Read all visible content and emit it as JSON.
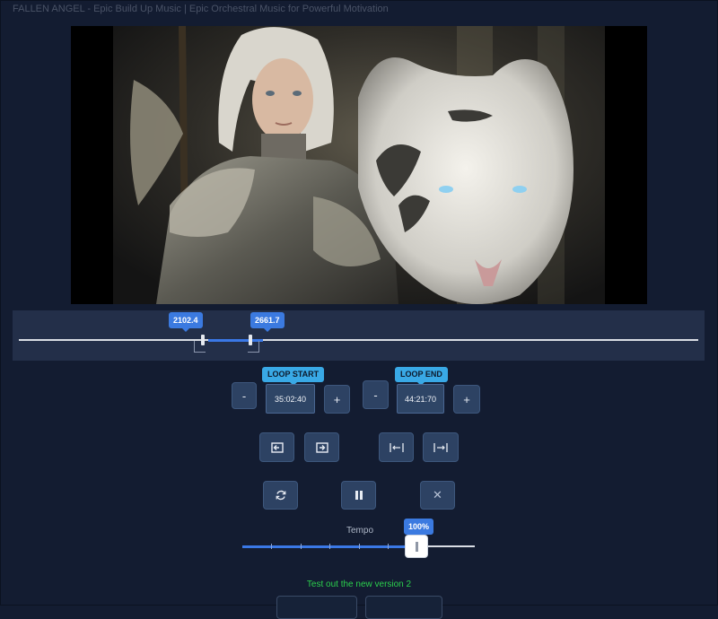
{
  "window": {
    "title": "FALLEN ANGEL - Epic Build Up Music | Epic Orchestral Music for Powerful Motivation"
  },
  "timeline": {
    "loop_start_value": "2102.4",
    "loop_end_value": "2661.7"
  },
  "loop": {
    "start_label": "LOOP START",
    "start_time": "35:02:40",
    "end_label": "LOOP END",
    "end_time": "44:21:70",
    "minus_label": "-",
    "plus_label": "+"
  },
  "controls": {
    "set_start_icon": "bracket-left-arrow-icon",
    "set_end_icon": "bracket-right-arrow-icon",
    "jump_start_icon": "skip-to-start-icon",
    "jump_end_icon": "skip-to-end-icon",
    "loop_icon": "refresh-icon",
    "pause_icon": "pause-icon",
    "close_icon": "close-icon",
    "close_glyph": "✕"
  },
  "tempo": {
    "label": "Tempo",
    "value_label": "100%",
    "fraction": 0.75
  },
  "promo": {
    "text": "Test out the new version 2"
  },
  "colors": {
    "background": "#131c31",
    "accent": "#3b7ae0",
    "pill": "#39a9e6",
    "promo_green": "#2bd04d"
  }
}
